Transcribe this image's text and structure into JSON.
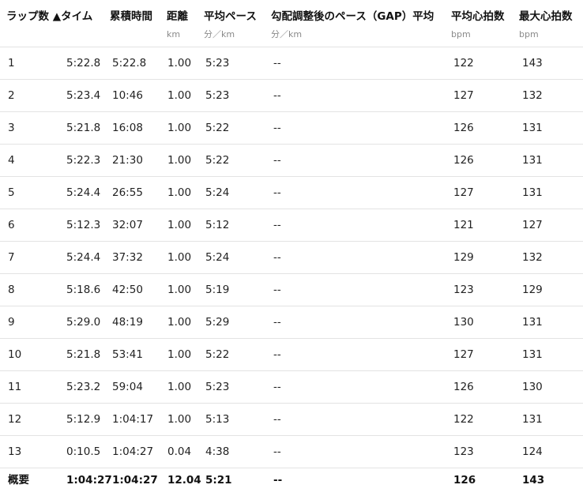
{
  "columns": [
    {
      "label": "ラップ数 ▲タイム",
      "unit": ""
    },
    {
      "label": "累積時間",
      "unit": ""
    },
    {
      "label": "距離",
      "unit": "km"
    },
    {
      "label": "平均ペース",
      "unit": "分／km"
    },
    {
      "label": "勾配調整後のペース（GAP）平均",
      "unit": "分／km"
    },
    {
      "label": "平均心拍数",
      "unit": "bpm"
    },
    {
      "label": "最大心拍数",
      "unit": "bpm"
    }
  ],
  "rows": [
    {
      "lap": "1",
      "time": "5:22.8",
      "cumulative": "5:22.8",
      "distance": "1.00",
      "pace": "5:23",
      "gap": "--",
      "avg_hr": "122",
      "max_hr": "143"
    },
    {
      "lap": "2",
      "time": "5:23.4",
      "cumulative": "10:46",
      "distance": "1.00",
      "pace": "5:23",
      "gap": "--",
      "avg_hr": "127",
      "max_hr": "132"
    },
    {
      "lap": "3",
      "time": "5:21.8",
      "cumulative": "16:08",
      "distance": "1.00",
      "pace": "5:22",
      "gap": "--",
      "avg_hr": "126",
      "max_hr": "131"
    },
    {
      "lap": "4",
      "time": "5:22.3",
      "cumulative": "21:30",
      "distance": "1.00",
      "pace": "5:22",
      "gap": "--",
      "avg_hr": "126",
      "max_hr": "131"
    },
    {
      "lap": "5",
      "time": "5:24.4",
      "cumulative": "26:55",
      "distance": "1.00",
      "pace": "5:24",
      "gap": "--",
      "avg_hr": "127",
      "max_hr": "131"
    },
    {
      "lap": "6",
      "time": "5:12.3",
      "cumulative": "32:07",
      "distance": "1.00",
      "pace": "5:12",
      "gap": "--",
      "avg_hr": "121",
      "max_hr": "127"
    },
    {
      "lap": "7",
      "time": "5:24.4",
      "cumulative": "37:32",
      "distance": "1.00",
      "pace": "5:24",
      "gap": "--",
      "avg_hr": "129",
      "max_hr": "132"
    },
    {
      "lap": "8",
      "time": "5:18.6",
      "cumulative": "42:50",
      "distance": "1.00",
      "pace": "5:19",
      "gap": "--",
      "avg_hr": "123",
      "max_hr": "129"
    },
    {
      "lap": "9",
      "time": "5:29.0",
      "cumulative": "48:19",
      "distance": "1.00",
      "pace": "5:29",
      "gap": "--",
      "avg_hr": "130",
      "max_hr": "131"
    },
    {
      "lap": "10",
      "time": "5:21.8",
      "cumulative": "53:41",
      "distance": "1.00",
      "pace": "5:22",
      "gap": "--",
      "avg_hr": "127",
      "max_hr": "131"
    },
    {
      "lap": "11",
      "time": "5:23.2",
      "cumulative": "59:04",
      "distance": "1.00",
      "pace": "5:23",
      "gap": "--",
      "avg_hr": "126",
      "max_hr": "130"
    },
    {
      "lap": "12",
      "time": "5:12.9",
      "cumulative": "1:04:17",
      "distance": "1.00",
      "pace": "5:13",
      "gap": "--",
      "avg_hr": "122",
      "max_hr": "131"
    },
    {
      "lap": "13",
      "time": "0:10.5",
      "cumulative": "1:04:27",
      "distance": "0.04",
      "pace": "4:38",
      "gap": "--",
      "avg_hr": "123",
      "max_hr": "124"
    }
  ],
  "summary": {
    "lap": "概要",
    "time": "1:04:27",
    "cumulative": "1:04:27",
    "distance": "12.04",
    "pace": "5:21",
    "gap": "--",
    "avg_hr": "126",
    "max_hr": "143"
  }
}
